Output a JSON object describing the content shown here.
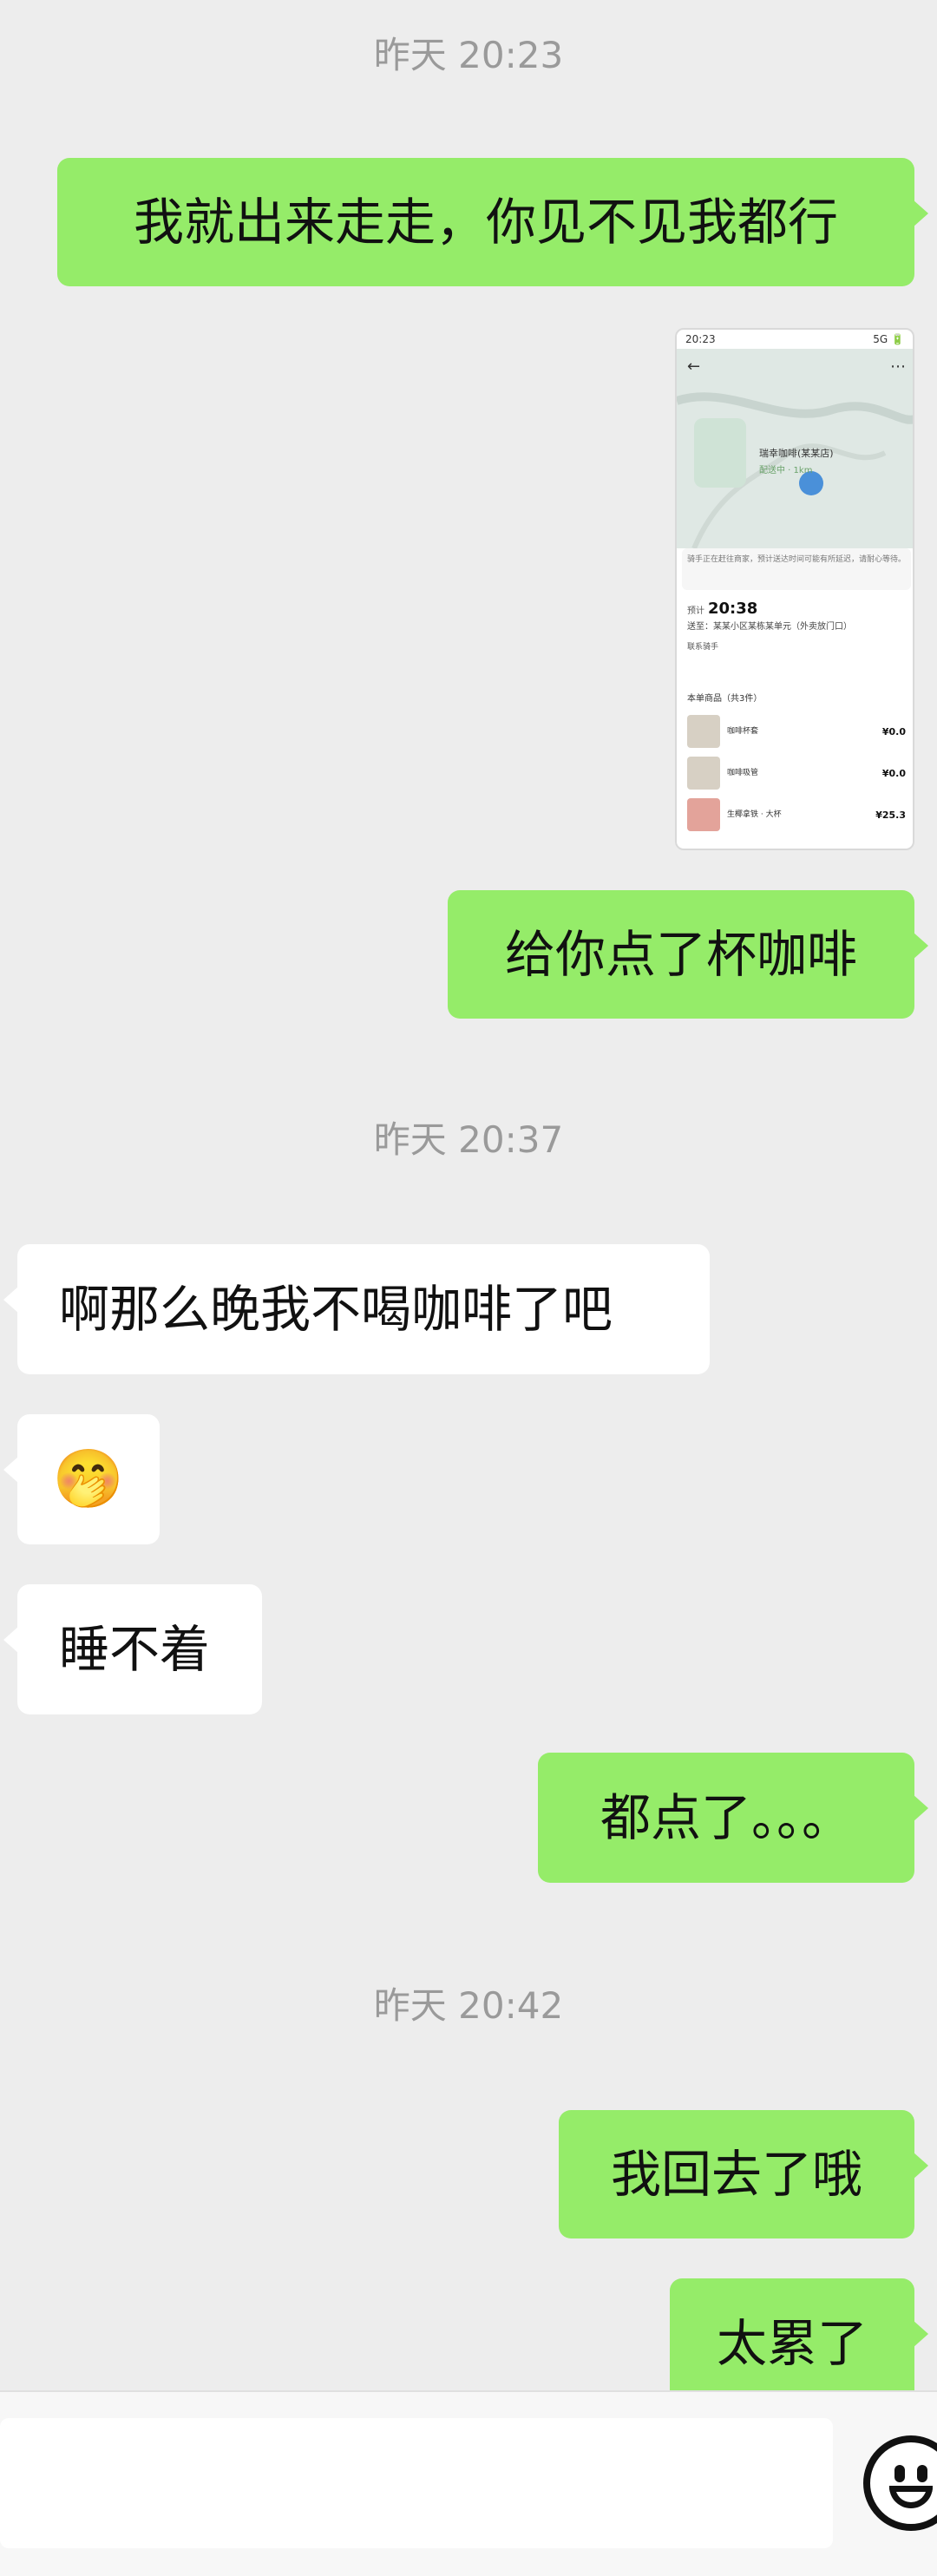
{
  "messages": {
    "ts1": "昨天 20:23",
    "m1": "我就出来走走，你见不见我都行",
    "m2": "给你点了杯咖啡",
    "ts2": "昨天 20:37",
    "m3": "啊那么晚我不喝咖啡了吧",
    "m4": "🤭",
    "m5": "睡不着",
    "m6": "都点了。。。",
    "ts3": "昨天 20:42",
    "m7": "我回去了哦",
    "m8": "太累了"
  },
  "screenshot": {
    "status_time": "20:23",
    "status_icons": "5G 🔋",
    "shop_name": "瑞幸咖啡(某某店)",
    "shop_sub": "配送中 · 1km",
    "notice": "骑手正在赶往商家，预计送达时间可能有所延迟，请耐心等待。",
    "eta_label": "预计",
    "eta_time": "20:38",
    "address": "送至：某某小区某栋某单元（外卖放门口）",
    "contact": "联系骑手",
    "order_header": "本单商品（共3件）",
    "items": [
      {
        "name": "咖啡杯套",
        "price": "¥0.0"
      },
      {
        "name": "咖啡吸管",
        "price": "¥0.0"
      },
      {
        "name": "生椰拿铁 · 大杯",
        "price": "¥25.3"
      }
    ]
  },
  "colors": {
    "my_bubble": "#95ec69",
    "other_bubble": "#ffffff",
    "background": "#ededed"
  },
  "icons": {
    "emoji_button": "smiley-face-icon"
  }
}
